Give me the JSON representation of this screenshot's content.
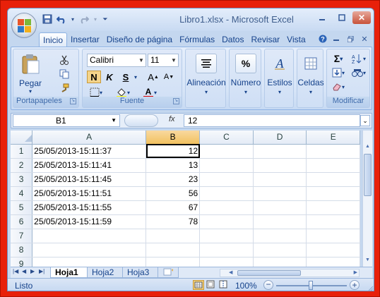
{
  "window": {
    "title": "Libro1.xlsx - Microsoft Excel"
  },
  "ribbon": {
    "tabs": [
      "Inicio",
      "Insertar",
      "Diseño de página",
      "Fórmulas",
      "Datos",
      "Revisar",
      "Vista"
    ],
    "active_tab": "Inicio",
    "clipboard": {
      "paste_label": "Pegar",
      "group_label": "Portapapeles"
    },
    "font": {
      "name": "Calibri",
      "size": "11",
      "group_label": "Fuente",
      "bold": "N",
      "italic": "K",
      "underline": "S"
    },
    "alignment": {
      "label": "Alineación"
    },
    "number": {
      "label": "Número"
    },
    "styles": {
      "label": "Estilos"
    },
    "cells": {
      "label": "Celdas"
    },
    "editing": {
      "group_label": "Modificar"
    }
  },
  "formula_bar": {
    "name_box": "B1",
    "fx": "fx",
    "value": "12"
  },
  "sheet": {
    "columns": [
      "A",
      "B",
      "C",
      "D",
      "E"
    ],
    "rows": [
      {
        "n": "1",
        "a": "25/05/2013-15:11:37",
        "b": "12"
      },
      {
        "n": "2",
        "a": "25/05/2013-15:11:41",
        "b": "13"
      },
      {
        "n": "3",
        "a": "25/05/2013-15:11:45",
        "b": "23"
      },
      {
        "n": "4",
        "a": "25/05/2013-15:11:51",
        "b": "56"
      },
      {
        "n": "5",
        "a": "25/05/2013-15:11:55",
        "b": "67"
      },
      {
        "n": "6",
        "a": "25/05/2013-15:11:59",
        "b": "78"
      },
      {
        "n": "7",
        "a": "",
        "b": ""
      },
      {
        "n": "8",
        "a": "",
        "b": ""
      },
      {
        "n": "9",
        "a": "",
        "b": ""
      }
    ],
    "tabs": [
      "Hoja1",
      "Hoja2",
      "Hoja3"
    ]
  },
  "status": {
    "ready": "Listo",
    "zoom": "100%"
  }
}
